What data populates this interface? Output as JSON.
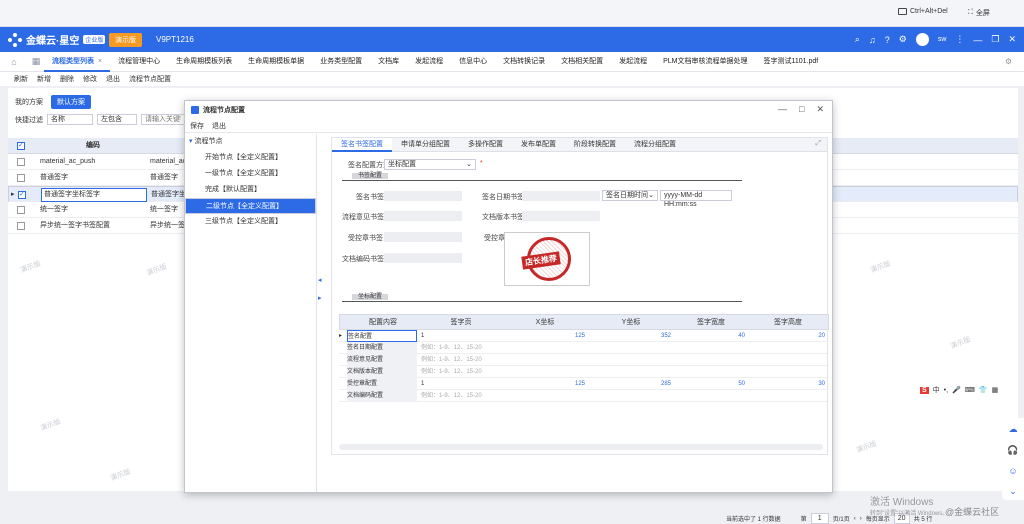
{
  "sysbar": {
    "ctrl_alt_del": "Ctrl+Alt+Del",
    "fullscreen": "全屏"
  },
  "header": {
    "logo_text": "金蝶云·星空",
    "logo_tag": "企业版",
    "demo_label": "演示版",
    "version": "V9PT1216",
    "user": "sw"
  },
  "tabs": [
    {
      "label": "流程类型列表",
      "active": true
    },
    {
      "label": "流程管理中心"
    },
    {
      "label": "生命周期模板列表"
    },
    {
      "label": "生命周期模板单据"
    },
    {
      "label": "业务类型配置"
    },
    {
      "label": "文档库"
    },
    {
      "label": "发起流程"
    },
    {
      "label": "信息中心"
    },
    {
      "label": "文档转换记录"
    },
    {
      "label": "文档相关配置"
    },
    {
      "label": "发起流程"
    },
    {
      "label": "PLM文档审核流程单据处理"
    },
    {
      "label": "签字测试1101.pdf"
    }
  ],
  "toolbar": [
    "刷新",
    "新增",
    "删除",
    "修改",
    "退出",
    "流程节点配置"
  ],
  "solutions": {
    "label": "我的方案",
    "default_btn": "默认方案"
  },
  "filter": {
    "label": "快捷过滤",
    "field": "名称",
    "op": "左包含",
    "placeholder": "请输入关键字"
  },
  "grid": {
    "header": "编码",
    "rows": [
      {
        "code": "material_ac_push",
        "name": "material_ac",
        "checked": false
      },
      {
        "code": "普通签字",
        "name": "普通签字",
        "checked": false
      },
      {
        "code": "普通签字坐标签字",
        "name": "普通签字坐",
        "checked": true
      },
      {
        "code": "统一签字",
        "name": "统一签字",
        "checked": false
      },
      {
        "code": "异步统一签字书签配置",
        "name": "异步统一签",
        "checked": false
      }
    ]
  },
  "status": {
    "selected": "当前选中了 1 行数据",
    "page_prefix": "第",
    "page": "1",
    "page_info": "页/1页",
    "per_page_label": "每页显示",
    "per_page": "20",
    "total": "共 5 行"
  },
  "dialog": {
    "title": "流程节点配置",
    "tools": [
      "保存",
      "退出"
    ],
    "tree": {
      "root": "流程节点",
      "nodes": [
        {
          "label": "开始节点【全定义配置】"
        },
        {
          "label": "一级节点【全定义配置】"
        },
        {
          "label": "完成【默认配置】"
        },
        {
          "label": "二级节点【全定义配置】",
          "selected": true
        },
        {
          "label": "三级节点【全定义配置】"
        }
      ]
    },
    "tabs": [
      "签名书签配置",
      "申请单分组配置",
      "多操作配置",
      "发布单配置",
      "阶段转换配置",
      "流程分组配置"
    ],
    "form": {
      "sign_mode_label": "签名配置方式",
      "sign_mode_value": "坐标配置",
      "bookmark_section": "书签配置",
      "sign_bookmark": "签名书签",
      "sign_date_bookmark": "签名日期书签",
      "date_type": "签名日期时间",
      "date_format": "yyyy-MM-dd HH:mm:ss",
      "opinion_bookmark": "流程意见书签",
      "version_bookmark": "文档版本书签",
      "stamp_bookmark": "受控章书签",
      "stamp_label": "受控章",
      "stamp_text": "店长推荐",
      "code_bookmark": "文档编码书签",
      "coord_section": "坐标配置"
    },
    "table": {
      "headers": [
        "配置内容",
        "签字页",
        "X坐标",
        "Y坐标",
        "签字宽度",
        "签字高度"
      ],
      "rows": [
        {
          "name": "签名配置",
          "page": "1",
          "x": "125",
          "y": "352",
          "w": "40",
          "h": "20",
          "current": true
        },
        {
          "name": "签名日期配置",
          "page": "例如：1-9、12、15-20",
          "x": "",
          "y": "",
          "w": "",
          "h": ""
        },
        {
          "name": "流程意见配置",
          "page": "例如：1-9、12、15-20",
          "x": "",
          "y": "",
          "w": "",
          "h": ""
        },
        {
          "name": "文档版本配置",
          "page": "例如：1-9、12、15-20",
          "x": "",
          "y": "",
          "w": "",
          "h": ""
        },
        {
          "name": "受控章配置",
          "page": "1",
          "x": "125",
          "y": "285",
          "w": "50",
          "h": "30"
        },
        {
          "name": "文档编码配置",
          "page": "例如：1-9、12、15-20",
          "x": "",
          "y": "",
          "w": "",
          "h": ""
        }
      ]
    }
  },
  "ime": {
    "lang": "中"
  },
  "watermark": "演示版",
  "win_activate": {
    "title": "激活 Windows",
    "sub": "转到\"设置\"以激活 Windows。"
  },
  "community": "@金蝶云社区",
  "colors": {
    "primary": "#2d6be6",
    "demo": "#f59a23",
    "seal": "#c62828"
  }
}
